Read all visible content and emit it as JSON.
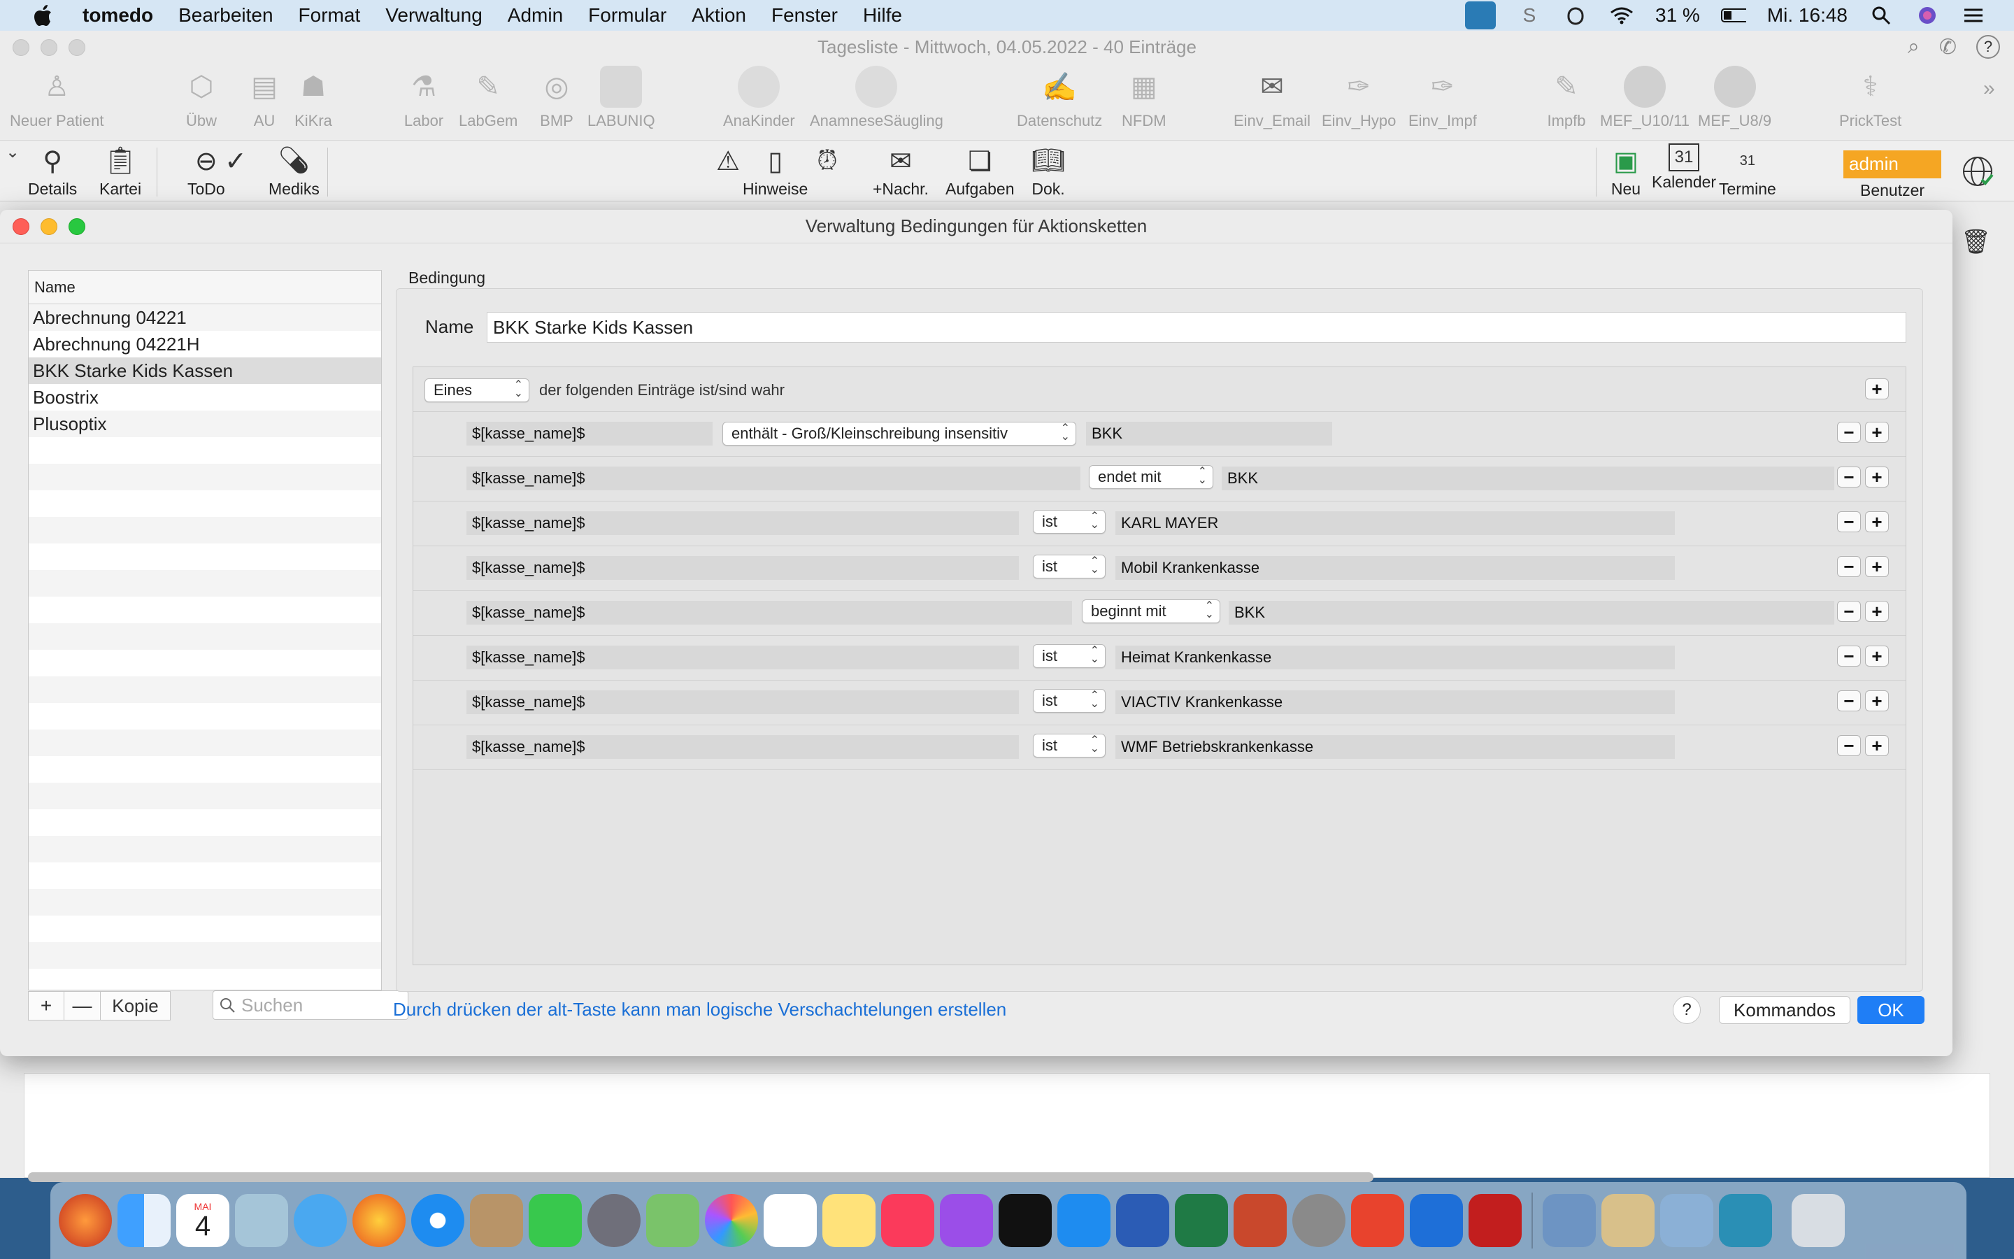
{
  "menubar": {
    "app": "tomedo",
    "items": [
      "Bearbeiten",
      "Format",
      "Verwaltung",
      "Admin",
      "Formular",
      "Aktion",
      "Fenster",
      "Hilfe"
    ],
    "battery": "31 %",
    "clock": "Mi. 16:48"
  },
  "main_window": {
    "title": "Tagesliste - Mittwoch, 04.05.2022 - 40 Einträge",
    "toolbar1": [
      "Neuer Patient",
      "Übw",
      "AU",
      "KiKra",
      "Labor",
      "LabGem",
      "BMP",
      "LABUNIQ",
      "AnaKinder",
      "AnamneseSäugling",
      "Datenschutz",
      "NFDM",
      "Einv_Email",
      "Einv_Hypo",
      "Einv_Impf",
      "Impfb",
      "MEF_U10/11",
      "MEF_U8/9",
      "PrickTest"
    ],
    "toolbar2": {
      "left": [
        "Details",
        "Kartei",
        "ToDo",
        "Mediks"
      ],
      "middle": [
        "Hinweise",
        "+Nachr.",
        "Aufgaben",
        "Dok."
      ],
      "right": [
        "Neu",
        "Kalender",
        "Termine"
      ],
      "user_badge": "admin",
      "user_label": "Benutzer"
    }
  },
  "dialog": {
    "title": "Verwaltung Bedingungen für Aktionsketten",
    "list": {
      "header": "Name",
      "items": [
        "Abrechnung 04221",
        "Abrechnung 04221H",
        "BKK Starke Kids Kassen",
        "Boostrix",
        "Plusoptix"
      ],
      "selected_index": 2
    },
    "footer": {
      "add": "+",
      "remove": "—",
      "copy": "Kopie",
      "search_placeholder": "Suchen"
    },
    "condition": {
      "section_label": "Bedingung",
      "name_label": "Name",
      "name_value": "BKK Starke Kids Kassen",
      "quantifier": "Eines",
      "quantifier_text": "der folgenden Einträge ist/sind wahr",
      "rules": [
        {
          "field": "$[kasse_name]$",
          "op": "enthält - Groß/Kleinschreibung insensitiv",
          "value": "BKK"
        },
        {
          "field": "$[kasse_name]$",
          "op": "endet mit",
          "value": "BKK"
        },
        {
          "field": "$[kasse_name]$",
          "op": "ist",
          "value": "KARL MAYER"
        },
        {
          "field": "$[kasse_name]$",
          "op": "ist",
          "value": "Mobil Krankenkasse"
        },
        {
          "field": "$[kasse_name]$",
          "op": "beginnt mit",
          "value": "BKK"
        },
        {
          "field": "$[kasse_name]$",
          "op": "ist",
          "value": "Heimat Krankenkasse"
        },
        {
          "field": "$[kasse_name]$",
          "op": "ist",
          "value": "VIACTIV Krankenkasse"
        },
        {
          "field": "$[kasse_name]$",
          "op": "ist",
          "value": "WMF Betriebskrankenkasse"
        }
      ]
    },
    "hint": "Durch drücken der alt-Taste kann man logische Verschachtelungen erstellen",
    "help": "?",
    "commands_button": "Kommandos",
    "ok_button": "OK"
  },
  "dock_calendar": {
    "month": "MAI",
    "day": "4"
  }
}
